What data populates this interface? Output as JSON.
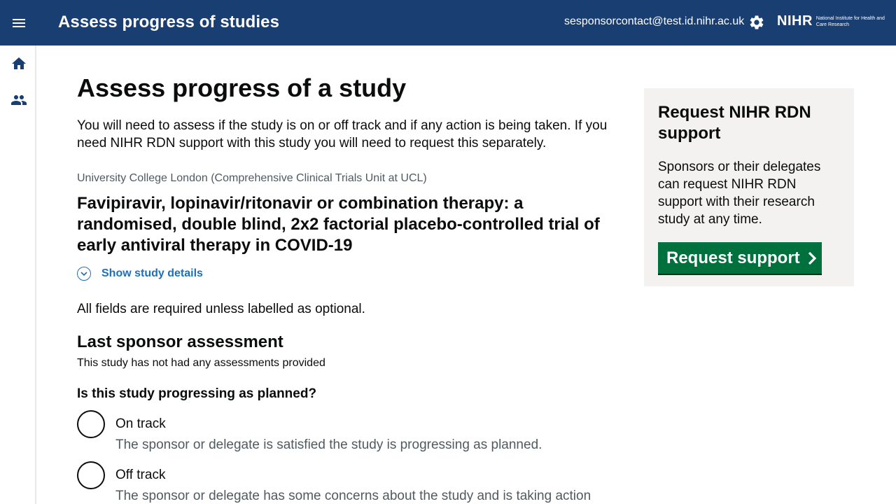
{
  "header": {
    "title": "Assess progress of studies",
    "user_email": "sesponsorcontact@test.id.nihr.ac.uk",
    "logo_mark": "NIHR",
    "logo_subtitle": "National Institute for Health and Care Research",
    "background_color": "#193e72"
  },
  "sidebar": {
    "items": [
      {
        "icon": "home-icon"
      },
      {
        "icon": "users-icon"
      }
    ]
  },
  "main": {
    "page_title": "Assess progress of a study",
    "intro": "You will need to assess if the study is on or off track and if any action is being taken. If you need NIHR RDN support with this study you will need to request this separately.",
    "organisation": "University College London (Comprehensive Clinical Trials Unit at UCL)",
    "study_title": "Favipiravir, lopinavir/ritonavir or combination therapy: a randomised, double blind, 2x2 factorial placebo-controlled trial of early antiviral therapy in COVID-19",
    "show_details_label": "Show study details",
    "required_note": "All fields are required unless labelled as optional.",
    "last_assessment_heading": "Last sponsor assessment",
    "last_assessment_text": "This study has not had any assessments provided",
    "question": "Is this study progressing as planned?",
    "options": [
      {
        "label": "On track",
        "hint": "The sponsor or delegate is satisfied the study is progressing as planned."
      },
      {
        "label": "Off track",
        "hint": "The sponsor or delegate has some concerns about the study and is taking action"
      }
    ]
  },
  "aside": {
    "title": "Request NIHR RDN support",
    "text": "Sponsors or their delegates can request NIHR RDN support with their research study at any time.",
    "button_label": "Request support",
    "button_color": "#00703c"
  }
}
